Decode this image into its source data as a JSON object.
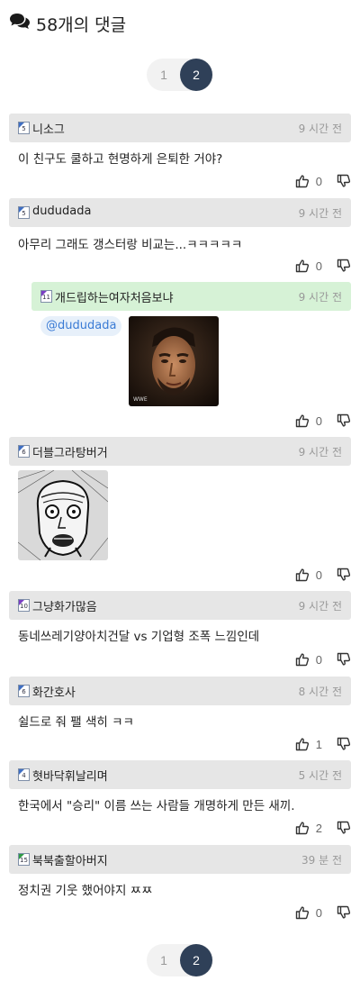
{
  "header": {
    "icon": "comments-icon",
    "title": "58개의 댓글"
  },
  "pagination": {
    "pages": [
      "1",
      "2"
    ],
    "current": "2"
  },
  "comments": [
    {
      "level": "5",
      "nick": "니소그",
      "time": "9 시간 전",
      "text": "이 친구도 쿨하고 현명하게 은퇴한 거야?",
      "likes": "0"
    },
    {
      "level": "5",
      "nick": "dududada",
      "time": "9 시간 전",
      "text": "아무리 그래도 갱스터랑 비교는...ㅋㅋㅋㅋㅋ",
      "likes": "0"
    },
    {
      "level": "11",
      "nick": "개드립하는여자처음보냐",
      "time": "9 시간 전",
      "mention": "@dududada",
      "image": "wrestler-face-photo",
      "likes": "0"
    },
    {
      "level": "6",
      "nick": "더블그라탕버거",
      "time": "9 시간 전",
      "image": "manga-shocked-face",
      "likes": "0"
    },
    {
      "level": "10",
      "nick": "그냥화가많음",
      "time": "9 시간 전",
      "text": "동네쓰레기양아치건달 vs 기업형 조폭 느낌인데",
      "likes": "0"
    },
    {
      "level": "6",
      "nick": "화간호사",
      "time": "8 시간 전",
      "text": "쉴드로 줘 팰 색히 ㅋㅋ",
      "likes": "1"
    },
    {
      "level": "4",
      "nick": "혓바닥휘날리며",
      "time": "5 시간 전",
      "text": "한국에서 \"승리\" 이름 쓰는 사람들 개명하게 만든 새끼.",
      "likes": "2"
    },
    {
      "level": "15",
      "nick": "북북출할아버지",
      "time": "39 분 전",
      "text": "정치권 기웃 했어야지 ㅉㅉ",
      "likes": "0"
    }
  ],
  "colors": {
    "accent": "#2f4058",
    "reply_bar": "#d6f2d6",
    "comment_bar": "#e6e6e6",
    "mention": "#3a7bd5"
  }
}
